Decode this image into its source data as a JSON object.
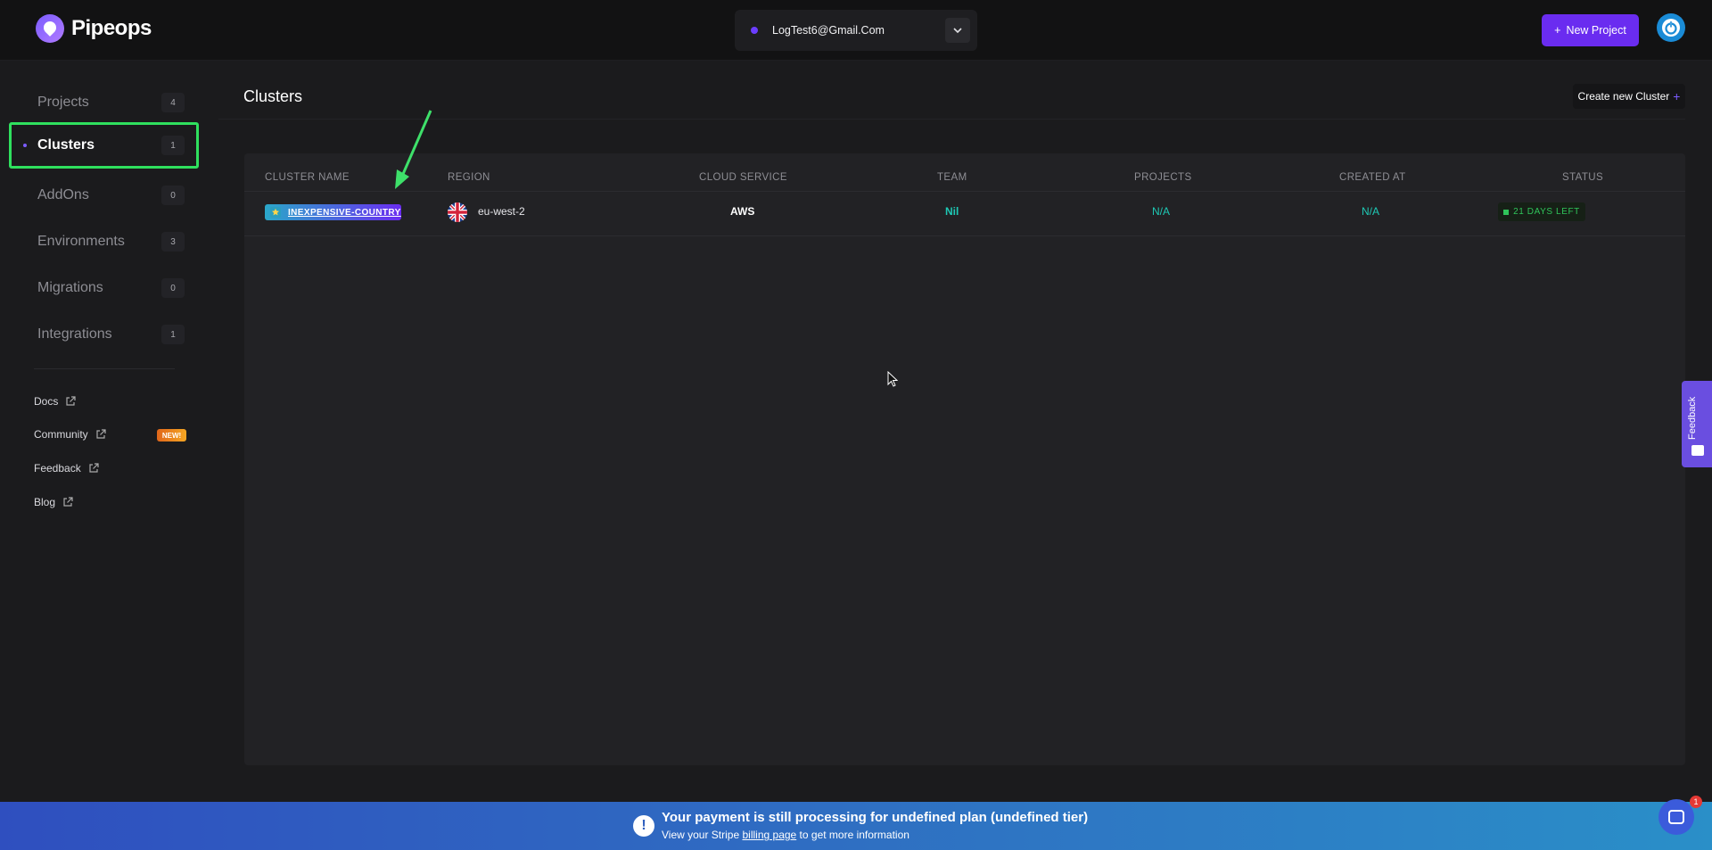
{
  "brand": {
    "name": "Pipeops"
  },
  "account": {
    "email": "LogTest6@Gmail.Com"
  },
  "header": {
    "new_project_label": "New Project",
    "new_project_plus": "+"
  },
  "sidebar": {
    "items": [
      {
        "label": "Projects",
        "count": "4"
      },
      {
        "label": "Clusters",
        "count": "1"
      },
      {
        "label": "AddOns",
        "count": "0"
      },
      {
        "label": "Environments",
        "count": "3"
      },
      {
        "label": "Migrations",
        "count": "0"
      },
      {
        "label": "Integrations",
        "count": "1"
      }
    ],
    "links": [
      {
        "label": "Docs"
      },
      {
        "label": "Community",
        "badge": "NEW!"
      },
      {
        "label": "Feedback"
      },
      {
        "label": "Blog"
      }
    ]
  },
  "main": {
    "title": "Clusters",
    "create_label": "Create new Cluster",
    "create_plus": "+",
    "table": {
      "columns": [
        "CLUSTER NAME",
        "REGION",
        "CLOUD SERVICE",
        "TEAM",
        "PROJECTS",
        "CREATED AT",
        "STATUS"
      ],
      "rows": [
        {
          "name": "INEXPENSIVE-COUNTRY",
          "region": "eu-west-2",
          "cloud": "AWS",
          "team": "Nil",
          "projects": "N/A",
          "created": "N/A",
          "status": "21 DAYS LEFT"
        }
      ]
    }
  },
  "feedback_tab": {
    "label": "Feedback"
  },
  "banner": {
    "icon": "!",
    "title": "Your payment is still processing for undefined plan (undefined tier)",
    "sub_before": "View your Stripe ",
    "sub_link": "billing page",
    "sub_after": " to get more information"
  },
  "chat": {
    "badge": "1"
  },
  "colors": {
    "accent": "#6a2cf0",
    "highlight": "#2fe05e",
    "teal": "#1ec9b5",
    "status_green": "#2fc45a"
  }
}
